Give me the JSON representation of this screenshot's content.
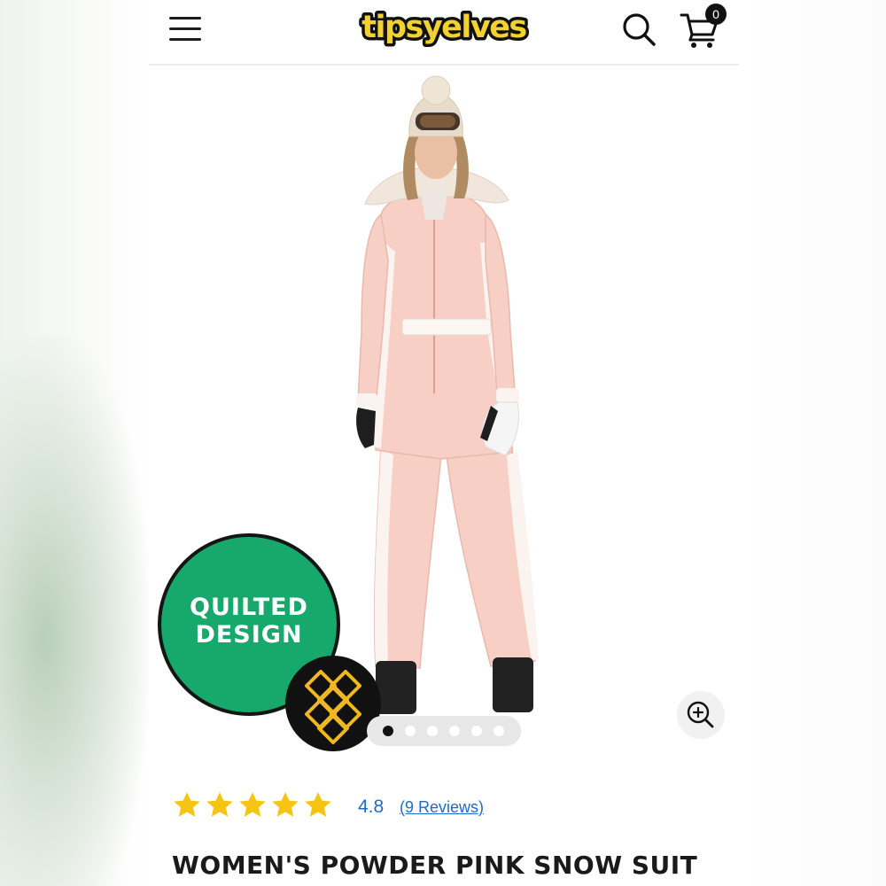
{
  "header": {
    "logo_text": "tipsyelves",
    "cart_count": "0",
    "icons": [
      "menu-icon",
      "search-icon",
      "cart-icon"
    ]
  },
  "product": {
    "image_alt": "Woman wearing a powder pink quilted ski suit with white side panels, fur-trimmed hood, beanie, goggles and black ski boots",
    "badge_text": "QUILTED\nDESIGN",
    "badge_icon": "diamond-quilt-pattern-icon",
    "carousel": {
      "total": 6,
      "active_index": 0
    },
    "zoom_icon": "zoom-in-icon"
  },
  "rating": {
    "stars": 5,
    "value": "4.8",
    "reviews_label": "(9 Reviews)"
  },
  "title": "WOMEN'S POWDER PINK SNOW SUIT",
  "colors": {
    "brand_green": "#17a86b",
    "logo_yellow": "#f2d230",
    "suit_pink": "#f7cfc4",
    "star_gold": "#f6c412",
    "link_blue": "#1e6cc7"
  }
}
